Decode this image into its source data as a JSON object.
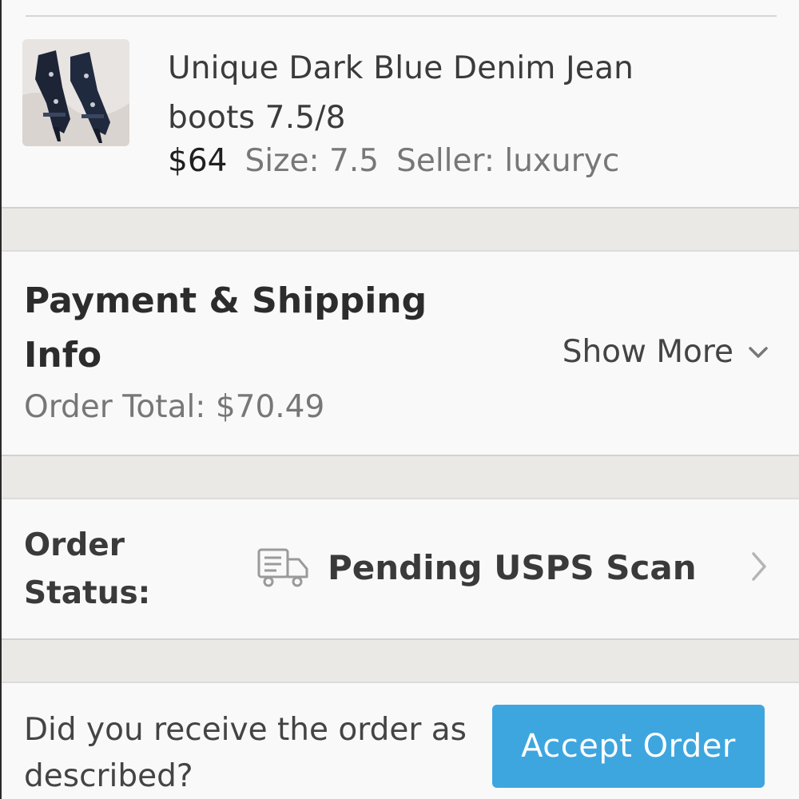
{
  "item": {
    "title": "Unique Dark Blue Denim Jean boots 7.5/8",
    "price": "$64",
    "size": "Size: 7.5",
    "seller": "Seller: luxuryc",
    "thumbnail_icon": "boots-photo"
  },
  "payment": {
    "title": "Payment & Shipping Info",
    "order_total": "Order Total: $70.49",
    "show_more_label": "Show More",
    "show_more_icon": "chevron-down-icon"
  },
  "order_status": {
    "label": "Order Status:",
    "value": "Pending USPS Scan",
    "icon": "truck-icon",
    "chevron_icon": "chevron-right-icon"
  },
  "accept": {
    "question": "Did you receive the order as described?",
    "button_label": "Accept Order"
  },
  "colors": {
    "accent": "#3ea6df",
    "background": "#faf9fa",
    "separator": "#ebe9e6"
  }
}
